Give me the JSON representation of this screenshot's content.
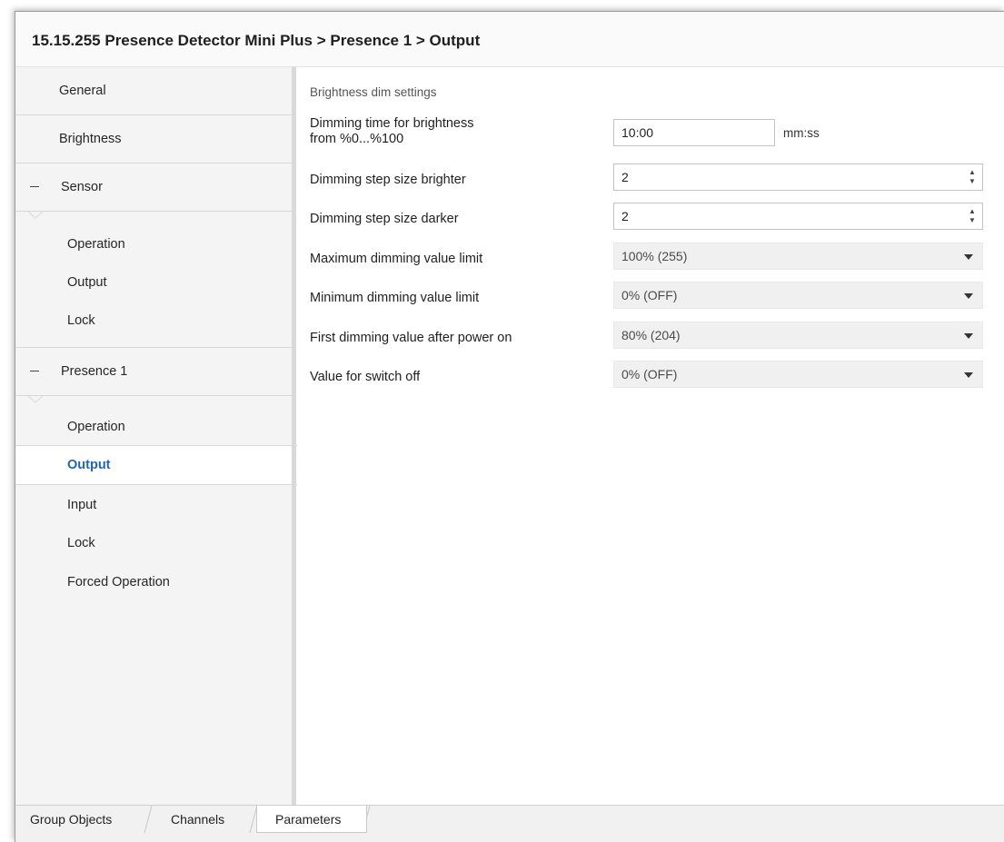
{
  "header": {
    "title": "15.15.255 Presence Detector Mini Plus > Presence 1 > Output"
  },
  "sidebar": {
    "general": "General",
    "brightness": "Brightness",
    "sensor": {
      "label": "Sensor",
      "items": [
        "Operation",
        "Output",
        "Lock"
      ]
    },
    "presence": {
      "label": "Presence 1",
      "items": [
        "Operation",
        "Output",
        "Input",
        "Lock",
        "Forced Operation"
      ],
      "selected": "Output"
    }
  },
  "content": {
    "section_title": "Brightness dim settings",
    "params": {
      "dimming_time": {
        "label_line1": "Dimming time for brightness",
        "label_line2": "from %0...%100",
        "value": "10:00",
        "unit": "mm:ss"
      },
      "step_brighter": {
        "label": "Dimming step size brighter",
        "value": "2"
      },
      "step_darker": {
        "label": "Dimming step size darker",
        "value": "2"
      },
      "max_limit": {
        "label": "Maximum dimming value limit",
        "value": "100% (255)"
      },
      "min_limit": {
        "label": "Minimum dimming value limit",
        "value": "0% (OFF)"
      },
      "first_value": {
        "label": "First dimming value after power on",
        "value": "80% (204)"
      },
      "switch_off": {
        "label": "Value for switch off",
        "value": "0% (OFF)"
      }
    }
  },
  "tabs": {
    "group_objects": "Group Objects",
    "channels": "Channels",
    "parameters": "Parameters",
    "active": "Parameters"
  }
}
